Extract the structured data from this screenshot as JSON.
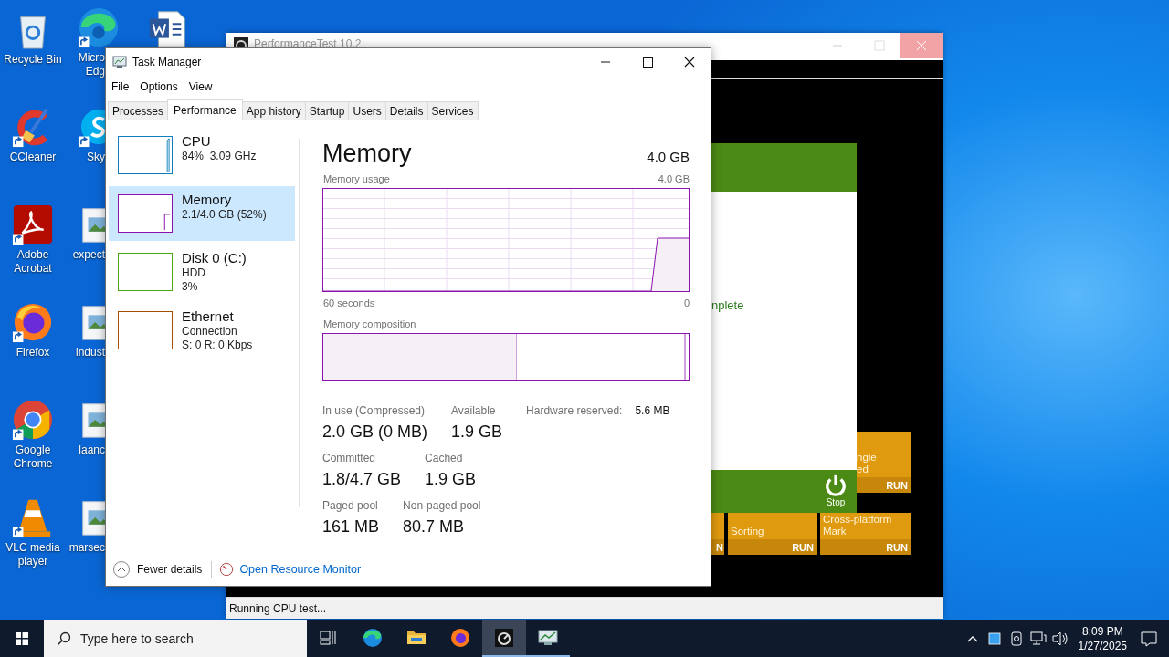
{
  "desktop": {
    "columns": [
      [
        {
          "kind": "recycle",
          "label": "Recycle Bin",
          "shortcut": false
        },
        {
          "kind": "ccleaner",
          "label": "CCleaner",
          "shortcut": true
        },
        {
          "kind": "acrobat",
          "label": "Adobe Acrobat",
          "shortcut": true
        },
        {
          "kind": "firefox",
          "label": "Firefox",
          "shortcut": true
        },
        {
          "kind": "chrome",
          "label": "Google Chrome",
          "shortcut": true
        },
        {
          "kind": "vlc",
          "label": "VLC media player",
          "shortcut": true
        }
      ],
      [
        {
          "kind": "edge",
          "label": "Micro Edg",
          "shortcut": true
        },
        {
          "kind": "skype",
          "label": "Sky",
          "shortcut": true
        },
        {
          "kind": "image",
          "label": "expect",
          "shortcut": false
        },
        {
          "kind": "image",
          "label": "indust",
          "shortcut": false
        },
        {
          "kind": "image",
          "label": "laanc",
          "shortcut": false
        },
        {
          "kind": "image",
          "label": "marsec",
          "shortcut": false
        }
      ],
      [
        {
          "kind": "word",
          "shortcut": false
        }
      ]
    ]
  },
  "background_window": {
    "title": "PerformanceTest 10.2",
    "panel_text": "nplete",
    "stop_label": "Stop",
    "status": "Running CPU test...",
    "tiles": [
      {
        "lines": [
          "ngle",
          "ed"
        ],
        "run": "RUN"
      },
      {
        "run": "N"
      },
      {
        "lines": [
          "Sorting"
        ],
        "run": "RUN"
      },
      {
        "lines": [
          "Cross-platform",
          "Mark"
        ],
        "run": "RUN"
      }
    ]
  },
  "task_manager": {
    "title": "Task Manager",
    "menu": [
      "File",
      "Options",
      "View"
    ],
    "tabs": [
      {
        "label": "Processes",
        "selected": false
      },
      {
        "label": "Performance",
        "selected": true
      },
      {
        "label": "App history",
        "selected": false
      },
      {
        "label": "Startup",
        "selected": false
      },
      {
        "label": "Users",
        "selected": false
      },
      {
        "label": "Details",
        "selected": false
      },
      {
        "label": "Services",
        "selected": false
      }
    ],
    "resources": [
      {
        "kind": "cpu",
        "name": "CPU",
        "lines": [
          "84%  3.09 GHz"
        ],
        "color": "#117dbb",
        "selected": false
      },
      {
        "kind": "memory",
        "name": "Memory",
        "lines": [
          "2.1/4.0 GB (52%)"
        ],
        "color": "#8b12ae",
        "selected": true
      },
      {
        "kind": "disk",
        "name": "Disk 0 (C:)",
        "lines": [
          "HDD",
          "3%"
        ],
        "color": "#4da60c",
        "selected": false
      },
      {
        "kind": "ethernet",
        "name": "Ethernet",
        "lines": [
          "Connection",
          "S: 0 R: 0 Kbps"
        ],
        "color": "#a74f01",
        "selected": false
      }
    ],
    "detail": {
      "title": "Memory",
      "total": "4.0 GB",
      "usage_label": "Memory usage",
      "usage_max": "4.0 GB",
      "time_span": "60 seconds",
      "time_end": "0",
      "composition_label": "Memory composition",
      "stats": [
        [
          {
            "kind": "stacked",
            "label": "In use (Compressed)",
            "value": "2.0 GB (0 MB)"
          },
          {
            "kind": "stacked",
            "label": "Available",
            "value": "1.9 GB"
          },
          {
            "kind": "inline",
            "label": "Hardware reserved:",
            "value": "5.6 MB"
          }
        ],
        [
          {
            "kind": "stacked",
            "label": "Committed",
            "value": "1.8/4.7 GB"
          },
          {
            "kind": "stacked",
            "label": "Cached",
            "value": "1.9 GB"
          }
        ],
        [
          {
            "kind": "stacked",
            "label": "Paged pool",
            "value": "161 MB"
          },
          {
            "kind": "stacked",
            "label": "Non-paged pool",
            "value": "80.7 MB"
          }
        ]
      ]
    },
    "footer": {
      "fewer_details": "Fewer details",
      "resource_monitor": "Open Resource Monitor"
    }
  },
  "taskbar": {
    "search_placeholder": "Type here to search",
    "apps": [
      {
        "kind": "taskview",
        "selected": false,
        "running": false
      },
      {
        "kind": "edge",
        "selected": false,
        "running": false
      },
      {
        "kind": "explorer",
        "selected": false,
        "running": false
      },
      {
        "kind": "firefox",
        "selected": false,
        "running": false
      },
      {
        "kind": "performancetest",
        "selected": true,
        "running": true
      },
      {
        "kind": "taskmanager",
        "selected": false,
        "running": true
      }
    ],
    "time": "8:09 PM",
    "date": "1/27/2025"
  }
}
